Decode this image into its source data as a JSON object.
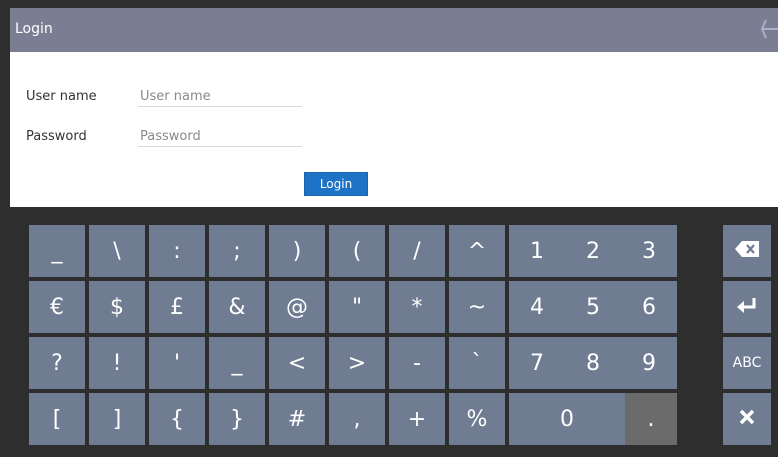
{
  "header": {
    "title": "Login",
    "back_icon": "back-arrow-icon"
  },
  "form": {
    "username": {
      "label": "User name",
      "placeholder": "User name",
      "value": ""
    },
    "password": {
      "label": "Password",
      "placeholder": "Password",
      "value": ""
    },
    "login_label": "Login"
  },
  "keyboard": {
    "rows": [
      [
        "_",
        "\\",
        ":",
        ";",
        ")",
        "(",
        "/",
        "^",
        "1",
        "2",
        "3"
      ],
      [
        "€",
        "$",
        "£",
        "&",
        "@",
        "\"",
        "*",
        "~",
        "4",
        "5",
        "6"
      ],
      [
        "?",
        "!",
        "'",
        "_",
        "<",
        ">",
        "-",
        "`",
        "7",
        "8",
        "9"
      ],
      [
        "[",
        "]",
        "{",
        "}",
        "#",
        ",",
        "+",
        "%",
        "0",
        "."
      ]
    ],
    "side": {
      "backspace_icon": "backspace-icon",
      "enter_icon": "enter-icon",
      "abc_label": "ABC",
      "close_icon": "close-icon"
    }
  },
  "colors": {
    "titlebar": "#7b7d93",
    "key": "#6f7c92",
    "key_dark": "#6b6b6b",
    "login_button": "#1f73c7",
    "keyboard_bg": "#2e2e2e"
  }
}
